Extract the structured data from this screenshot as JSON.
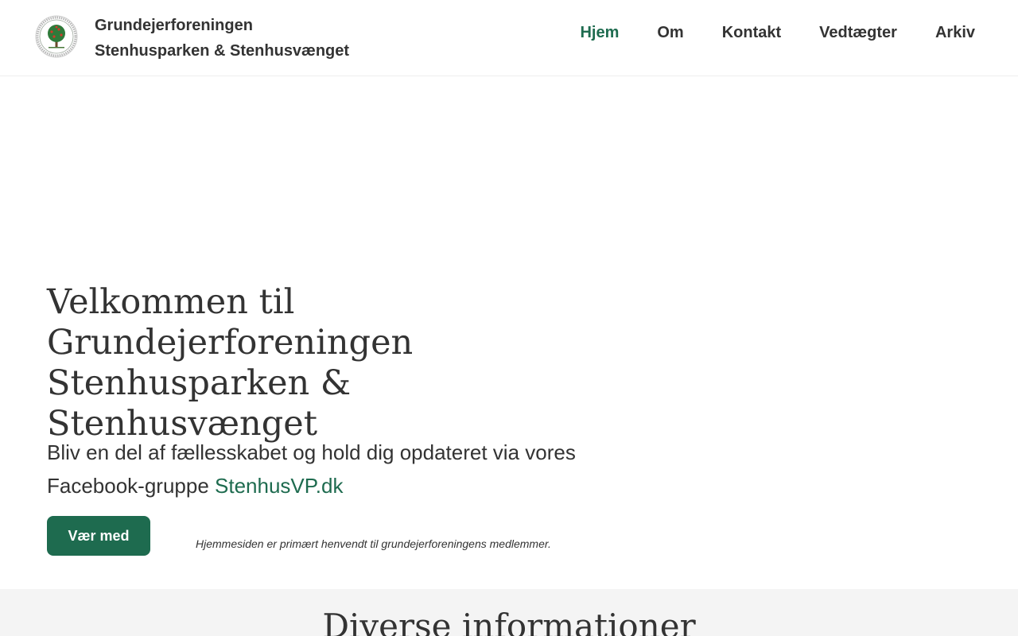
{
  "header": {
    "site_name_line1": "Grundejerforeningen",
    "site_name_line2": "Stenhusparken & Stenhusvænget"
  },
  "nav": {
    "items": [
      {
        "label": "Hjem",
        "active": true
      },
      {
        "label": "Om",
        "active": false
      },
      {
        "label": "Kontakt",
        "active": false
      },
      {
        "label": "Vedtægter",
        "active": false
      },
      {
        "label": "Arkiv",
        "active": false
      }
    ]
  },
  "hero": {
    "title_line1": "Velkommen til",
    "title_line2": "Grundejerforeningen",
    "title_line3": "Stenhusparken & Stenhusvænget",
    "text_line1": "Bliv en del af fællesskabet og hold dig opdateret via vores",
    "text_line2_prefix": "Facebook-gruppe ",
    "link_text": "StenhusVP.dk",
    "cta_label": "Vær med",
    "note": "Hjemmesiden er primært henvendt til grundejerforeningens medlemmer."
  },
  "section": {
    "title": "Diverse informationer"
  },
  "colors": {
    "accent": "#1e6b4f",
    "text": "#333333",
    "section_bg": "#f4f4f4"
  },
  "icons": {
    "logo": "tree-seal-logo"
  }
}
